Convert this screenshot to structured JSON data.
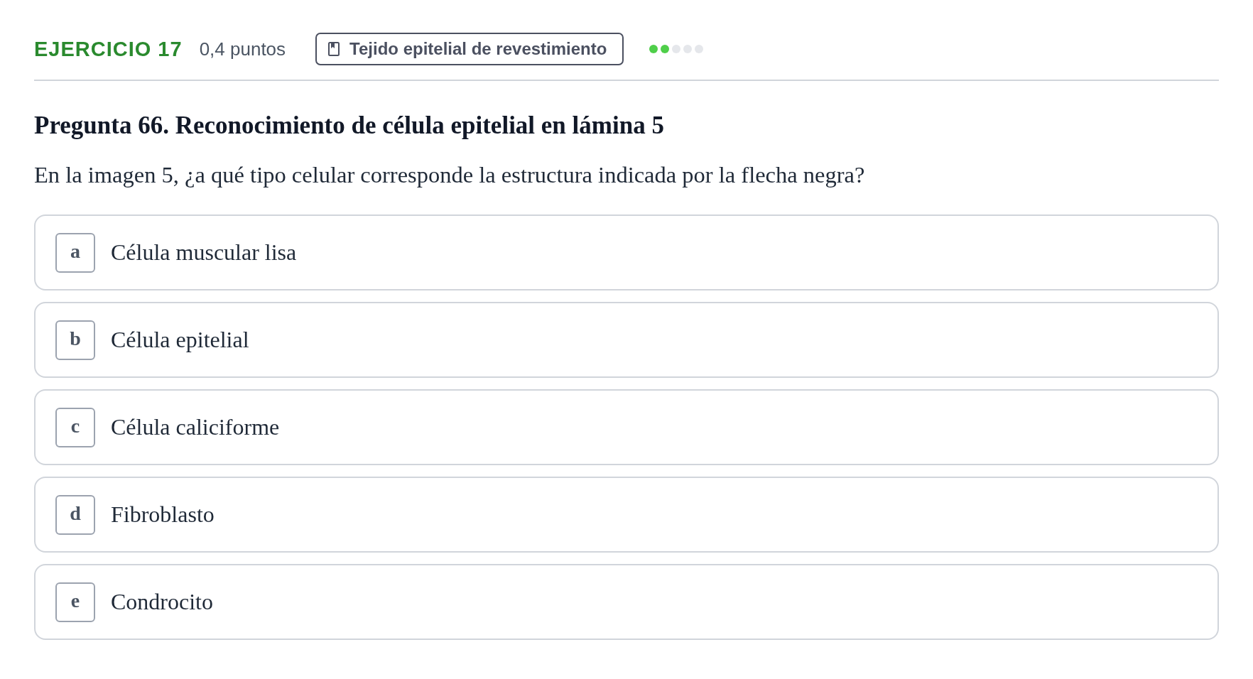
{
  "header": {
    "exercise": "EJERCICIO 17",
    "points": "0,4 puntos",
    "topic": "Tejido epitelial de revestimiento",
    "difficulty_dots": [
      {
        "filled": true
      },
      {
        "filled": true
      },
      {
        "filled": false
      },
      {
        "filled": false
      },
      {
        "filled": false
      }
    ]
  },
  "question": {
    "title": "Pregunta 66. Reconocimiento de célula epitelial en lámina 5",
    "prompt": "En la imagen 5, ¿a qué tipo celular corresponde la estructura indicada por la flecha negra?"
  },
  "options": [
    {
      "letter": "a",
      "text": "Célula muscular lisa",
      "selected": false
    },
    {
      "letter": "b",
      "text": "Célula epitelial",
      "selected": false
    },
    {
      "letter": "c",
      "text": "Célula caliciforme",
      "selected": false
    },
    {
      "letter": "d",
      "text": "Fibroblasto",
      "selected": false
    },
    {
      "letter": "e",
      "text": "Condrocito",
      "selected": false
    }
  ]
}
